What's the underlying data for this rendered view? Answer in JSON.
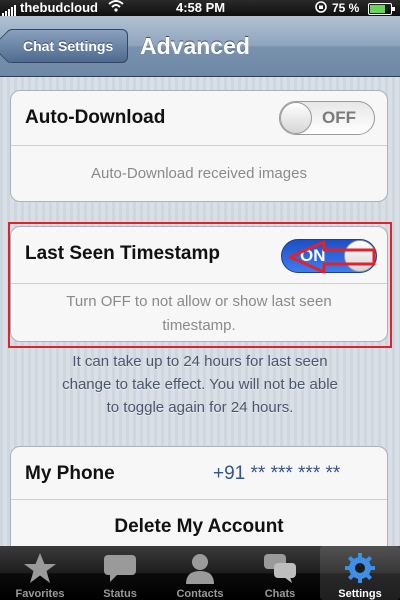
{
  "status_bar": {
    "carrier": "thebudcloud",
    "time": "4:58 PM",
    "battery_percent": "75 %"
  },
  "nav": {
    "back_label": "Chat Settings",
    "title": "Advanced"
  },
  "auto_download": {
    "label": "Auto-Download",
    "toggle_state": "OFF",
    "hint": "Auto-Download received images"
  },
  "last_seen": {
    "label": "Last Seen Timestamp",
    "toggle_state": "ON",
    "hint_line1": "Turn OFF to not allow or show last seen",
    "hint_line2": "timestamp."
  },
  "footnote": {
    "line1": "It can take up to 24 hours for last seen",
    "line2": "change to take effect. You will not be able",
    "line3": "to toggle again for 24 hours."
  },
  "account": {
    "phone_label": "My Phone",
    "phone_value": "+91 ** *** *** **",
    "delete_label": "Delete My Account"
  },
  "tabs": [
    {
      "label": "Favorites",
      "icon": "star-icon"
    },
    {
      "label": "Status",
      "icon": "speech-bubble-icon"
    },
    {
      "label": "Contacts",
      "icon": "person-icon"
    },
    {
      "label": "Chats",
      "icon": "chats-icon"
    },
    {
      "label": "Settings",
      "icon": "gear-icon",
      "selected": true
    }
  ],
  "colors": {
    "toggle_on": "#2f66de",
    "highlight": "#e0222c",
    "nav_bar": "#7a92ae"
  }
}
